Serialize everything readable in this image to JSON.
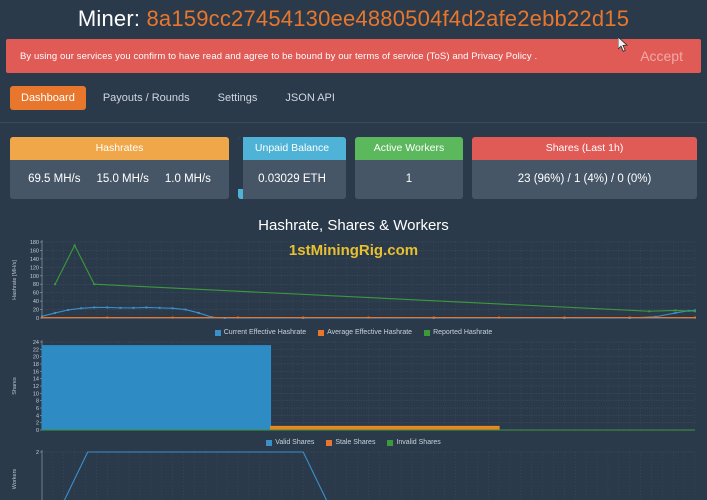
{
  "header": {
    "title_prefix": "Miner:",
    "miner_address": "8a159cc27454130ee4880504f4d2afe2ebb22d15",
    "address_color": "#e8762c"
  },
  "tos_banner": {
    "text": "By using our services you confirm to have read and agree to be bound by our terms of service (ToS) and Privacy Policy .",
    "accept_label": "Accept",
    "background_color": "#e05a56"
  },
  "tabs": [
    {
      "label": "Dashboard",
      "active": true
    },
    {
      "label": "Payouts / Rounds",
      "active": false
    },
    {
      "label": "Settings",
      "active": false
    },
    {
      "label": "JSON API",
      "active": false
    }
  ],
  "stats": {
    "hashrates": {
      "title": "Hashrates",
      "accent": "#f0a74a",
      "values": [
        "69.5 MH/s",
        "15.0 MH/s",
        "1.0 MH/s"
      ]
    },
    "unpaid_balance": {
      "title": "Unpaid Balance",
      "accent": "#4eb3d6",
      "value": "0.03029 ETH"
    },
    "active_workers": {
      "title": "Active Workers",
      "accent": "#5cb85c",
      "value": "1"
    },
    "shares_last_1h": {
      "title": "Shares (Last 1h)",
      "accent": "#e05a56",
      "value": "23 (96%) / 1 (4%) / 0 (0%)"
    }
  },
  "charts_section": {
    "title": "Hashrate, Shares & Workers",
    "watermark": "1stMiningRig.com"
  },
  "chart_data": [
    {
      "type": "line",
      "name": "hashrate-chart",
      "title": "",
      "ylabel": "Hashrate [MH/s]",
      "xlabel": "",
      "ylim": [
        0,
        180
      ],
      "yticks": [
        0,
        20,
        40,
        60,
        80,
        100,
        120,
        140,
        160,
        180
      ],
      "grid": true,
      "legend_position": "bottom",
      "series": [
        {
          "name": "Current Effective Hashrate",
          "color": "#3b90cc",
          "points": [
            [
              0,
              4
            ],
            [
              2,
              12
            ],
            [
              4,
              19
            ],
            [
              6,
              23
            ],
            [
              8,
              25
            ],
            [
              10,
              25
            ],
            [
              12,
              24
            ],
            [
              14,
              24
            ],
            [
              16,
              25
            ],
            [
              18,
              24
            ],
            [
              20,
              23
            ],
            [
              22,
              20
            ],
            [
              24,
              12
            ],
            [
              26,
              2
            ],
            [
              28,
              0
            ],
            [
              40,
              0
            ],
            [
              60,
              0
            ],
            [
              80,
              0
            ],
            [
              90,
              0
            ],
            [
              94,
              3
            ],
            [
              97,
              12
            ],
            [
              99,
              17
            ],
            [
              100,
              18
            ]
          ]
        },
        {
          "name": "Average Effective Hashrate",
          "color": "#e8762c",
          "points": [
            [
              0,
              1
            ],
            [
              10,
              1
            ],
            [
              20,
              1
            ],
            [
              30,
              1
            ],
            [
              40,
              1
            ],
            [
              50,
              1
            ],
            [
              60,
              1
            ],
            [
              70,
              1
            ],
            [
              80,
              1
            ],
            [
              90,
              1
            ],
            [
              100,
              1
            ]
          ]
        },
        {
          "name": "Reported Hashrate",
          "color": "#3c9a3c",
          "points": [
            [
              2,
              80
            ],
            [
              5,
              172
            ],
            [
              8,
              80
            ],
            [
              93,
              16
            ],
            [
              97,
              18
            ],
            [
              100,
              16
            ]
          ]
        }
      ]
    },
    {
      "type": "area",
      "name": "shares-chart",
      "title": "",
      "ylabel": "Shares",
      "xlabel": "",
      "ylim": [
        0,
        24
      ],
      "yticks": [
        0,
        2,
        4,
        6,
        8,
        10,
        12,
        14,
        16,
        18,
        20,
        22,
        24
      ],
      "grid": true,
      "legend_position": "bottom",
      "series": [
        {
          "name": "Valid Shares",
          "color": "#2e8fc9",
          "points": [
            [
              0,
              23
            ],
            [
              35,
              23
            ],
            [
              35,
              0
            ],
            [
              100,
              0
            ]
          ]
        },
        {
          "name": "Stale Shares",
          "color": "#f08a1e",
          "points": [
            [
              35,
              1
            ],
            [
              70,
              1
            ],
            [
              70,
              0
            ],
            [
              100,
              0
            ]
          ]
        },
        {
          "name": "Invalid Shares",
          "color": "#3c9a3c",
          "points": [
            [
              0,
              0
            ],
            [
              100,
              0
            ]
          ]
        }
      ]
    },
    {
      "type": "line",
      "name": "workers-chart",
      "title": "",
      "ylabel": "Workers",
      "xlabel": "",
      "ylim": [
        0,
        2
      ],
      "yticks": [
        2,
        2,
        2,
        2,
        2,
        2
      ],
      "grid": true,
      "series": [
        {
          "name": "Workers",
          "color": "#3b90cc",
          "points": [
            [
              3,
              0
            ],
            [
              7,
              2
            ],
            [
              40,
              2
            ],
            [
              44,
              0
            ],
            [
              100,
              0
            ]
          ]
        }
      ]
    }
  ],
  "legends": {
    "hashrate": [
      {
        "label": "Current Effective Hashrate",
        "color": "#3b90cc"
      },
      {
        "label": "Average Effective Hashrate",
        "color": "#e8762c"
      },
      {
        "label": "Reported Hashrate",
        "color": "#3c9a3c"
      }
    ],
    "shares": [
      {
        "label": "Valid Shares",
        "color": "#3b90cc"
      },
      {
        "label": "Stale Shares",
        "color": "#e8762c"
      },
      {
        "label": "Invalid Shares",
        "color": "#3c9a3c"
      }
    ]
  }
}
